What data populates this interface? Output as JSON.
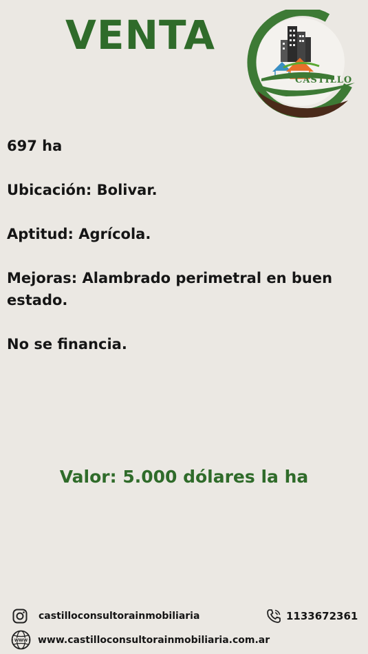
{
  "header": {
    "title": "VENTA"
  },
  "logo": {
    "brand_text": "CASTILLO",
    "colors": {
      "green": "#3d7a35",
      "brown": "#4a2a1a",
      "orange": "#e8702a",
      "blue": "#3a8fc4"
    }
  },
  "details": [
    {
      "text": "697 ha"
    },
    {
      "text": "Ubicación: Bolivar."
    },
    {
      "text": "Aptitud: Agrícola."
    },
    {
      "text": "Mejoras: Alambrado perimetral en buen estado."
    },
    {
      "text": "No se financia."
    }
  ],
  "price": {
    "text": "Valor: 5.000 dólares la ha"
  },
  "contact": {
    "instagram": "castilloconsultorainmobiliaria",
    "phone": "1133672361",
    "website": "www.castilloconsultorainmobiliaria.com.ar",
    "icons": [
      "instagram-icon",
      "phone-icon",
      "www-globe-icon"
    ]
  }
}
